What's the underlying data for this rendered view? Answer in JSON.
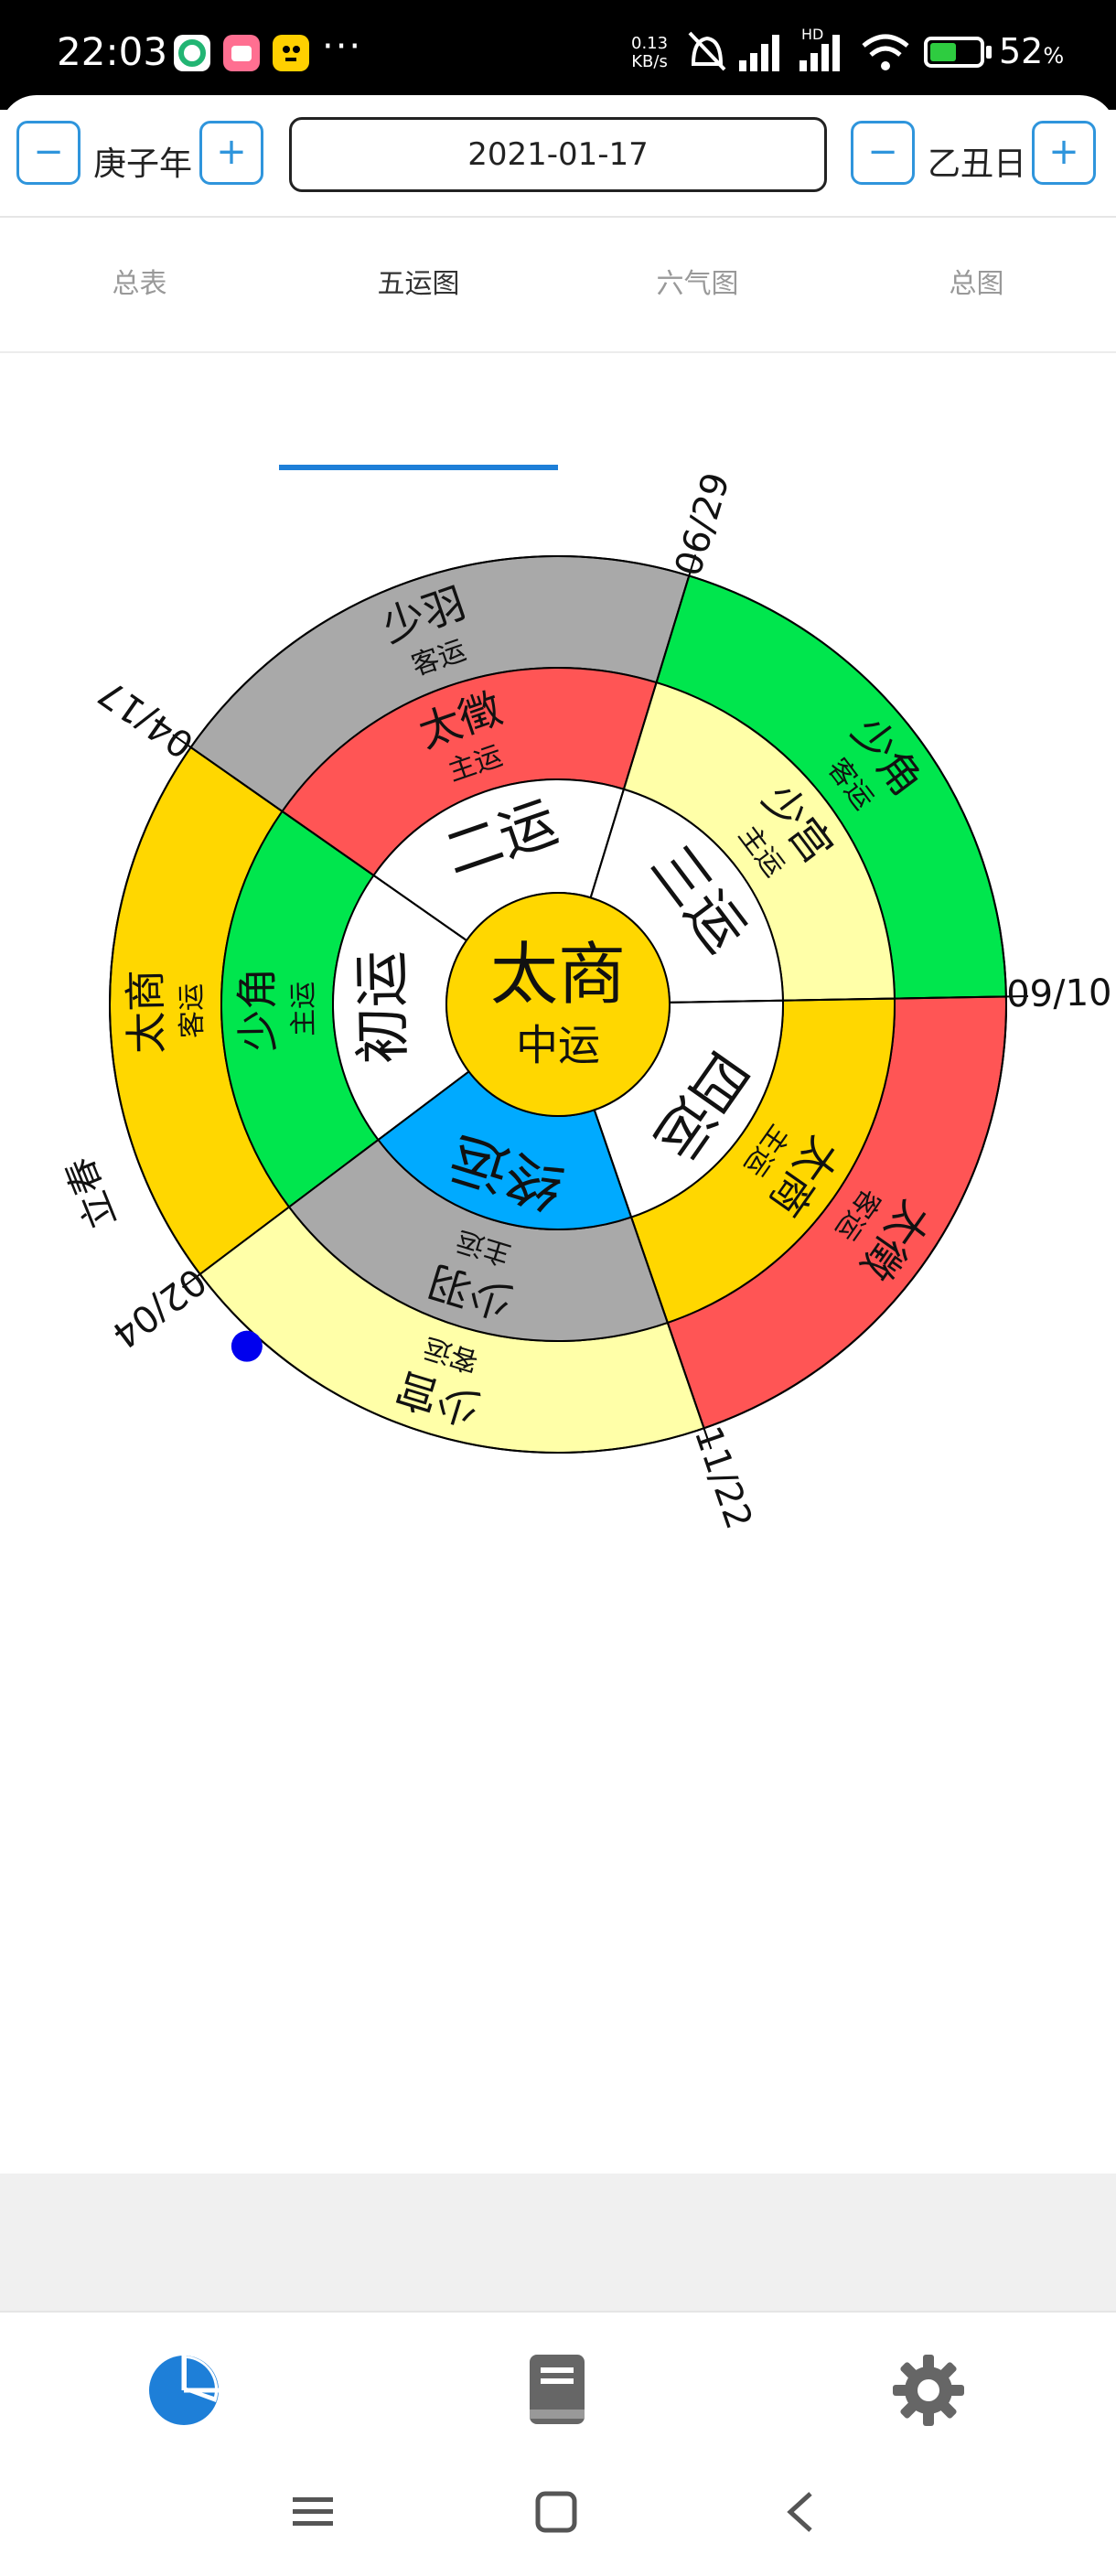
{
  "status": {
    "time": "22:03",
    "dots": "···",
    "speed_value": "0.13",
    "speed_unit": "KB/s",
    "hd_label": "HD",
    "battery": "52",
    "battery_unit": "%"
  },
  "controls": {
    "year_label": "庚子年",
    "day_label": "乙丑日",
    "minus": "−",
    "plus": "+",
    "date": "2021-01-17"
  },
  "tabs": [
    {
      "label": "总表"
    },
    {
      "label": "五运图"
    },
    {
      "label": "六气图"
    },
    {
      "label": "总图"
    }
  ],
  "chart": {
    "center_main": "太商",
    "center_sub": "中运",
    "steps": [
      "初运",
      "二运",
      "三运",
      "四运",
      "终运"
    ],
    "main_elements": [
      "少角",
      "太徵",
      "少宫",
      "太商",
      "少羽"
    ],
    "main_sub": "主运",
    "guest_elements": [
      "太商",
      "少羽",
      "少角",
      "太徵",
      "少宫"
    ],
    "guest_sub": "客运",
    "dates": [
      "04/17",
      "06/29",
      "09/10",
      "11/22",
      "02/04"
    ],
    "start_term": "立春",
    "colors": {
      "wood": "#00e64d",
      "fire": "#ff5555",
      "earth": "#ffffa8",
      "metal": "#ffd700",
      "water": "#a9a9a9",
      "center": "#ffd700",
      "final_step": "#00aaff",
      "marker": "#0000ee"
    },
    "main_colors": [
      "wood",
      "fire",
      "earth",
      "metal",
      "water"
    ],
    "guest_colors": [
      "metal",
      "water",
      "wood",
      "fire",
      "earth"
    ]
  }
}
